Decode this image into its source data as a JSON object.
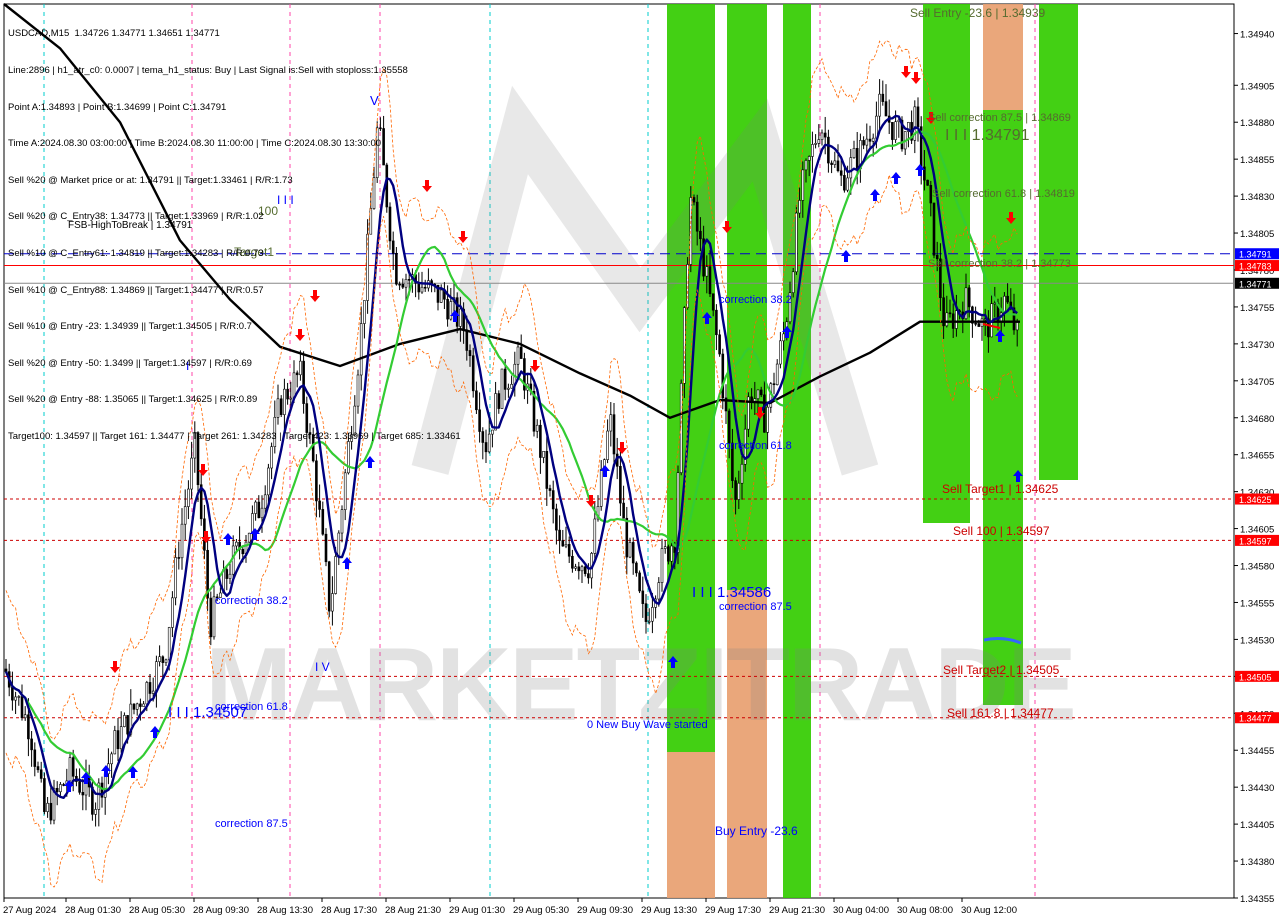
{
  "header": {
    "symbol_line": "USDCAD,M15  1.34726 1.34771 1.34651 1.34771",
    "info_lines": [
      "Line:2896 | h1_atr_c0: 0.0007 | tema_h1_status: Buy | Last Signal is:Sell with stoploss:1.35558",
      "Point A:1.34893 | Point B:1.34699 | Point C:1.34791",
      "Time A:2024.08.30 03:00:00 | Time B:2024.08.30 11:00:00 | Time C:2024.08.30 13:30:00",
      "Sell %20 @ Market price or at: 1.34791 || Target:1.33461 | R/R:1.73",
      "Sell %20 @ C_Entry38: 1.34773 || Target:1.33969 | R/R:1.02",
      "Sell %10 @ C_Entry61: 1.34819 || Target:1.34283 | R/R:0.73",
      "Sell %10 @ C_Entry88: 1.34869 || Target:1.34477 | R/R:0.57",
      "Sell %10 @ Entry -23: 1.34939 || Target:1.34505 | R/R:0.7",
      "Sell %20 @ Entry -50: 1.3499 || Target:1.34597 | R/R:0.69",
      "Sell %20 @ Entry -88: 1.35065 || Target:1.34625 | R/R:0.89",
      "Target100: 1.34597 || Target 161: 1.34477 | Target 261: 1.34283 | Target 423: 1.33969 | Target 685: 1.33461"
    ]
  },
  "chart_data": {
    "type": "candlestick",
    "symbol": "USDCAD",
    "timeframe": "M15",
    "ylim": [
      1.34355,
      1.3496
    ],
    "y_ticks": [
      "1.34940",
      "1.34905",
      "1.34880",
      "1.34855",
      "1.34830",
      "1.34805",
      "1.34780",
      "1.34755",
      "1.34730",
      "1.34705",
      "1.34680",
      "1.34655",
      "1.34630",
      "1.34605",
      "1.34580",
      "1.34555",
      "1.34530",
      "1.34505",
      "1.34480",
      "1.34455",
      "1.34430",
      "1.34405",
      "1.34380",
      "1.34355"
    ],
    "x_ticks": [
      "27 Aug 2024",
      "28 Aug 01:30",
      "28 Aug 05:30",
      "28 Aug 09:30",
      "28 Aug 13:30",
      "28 Aug 17:30",
      "28 Aug 21:30",
      "29 Aug 01:30",
      "29 Aug 05:30",
      "29 Aug 09:30",
      "29 Aug 13:30",
      "29 Aug 17:30",
      "29 Aug 21:30",
      "30 Aug 04:00",
      "30 Aug 08:00",
      "30 Aug 12:00"
    ],
    "price_badges": [
      {
        "value": "1.34791",
        "color": "#0000ff"
      },
      {
        "value": "1.34783",
        "color": "#ff0000"
      },
      {
        "value": "1.34771",
        "color": "#000000"
      },
      {
        "value": "1.34625",
        "color": "#ff0000"
      },
      {
        "value": "1.34597",
        "color": "#ff0000"
      },
      {
        "value": "1.34505",
        "color": "#ff0000"
      },
      {
        "value": "1.34477",
        "color": "#ff0000"
      }
    ],
    "horizontal_levels": [
      {
        "price": 1.34791,
        "color": "#0000cc",
        "style": "dashed"
      },
      {
        "price": 1.34783,
        "color": "#ff0000",
        "style": "solid"
      },
      {
        "price": 1.34771,
        "color": "#888888",
        "style": "solid"
      },
      {
        "price": 1.34625,
        "color": "#cc0000",
        "style": "dotted"
      },
      {
        "price": 1.34597,
        "color": "#cc0000",
        "style": "dotted"
      },
      {
        "price": 1.34505,
        "color": "#cc0000",
        "style": "dotted"
      },
      {
        "price": 1.34477,
        "color": "#cc0000",
        "style": "dotted"
      }
    ],
    "annotations": [
      {
        "text": "FSB-HighToBreak | 1.34791",
        "color": "#000000"
      },
      {
        "text": "Target1",
        "color": "#556b2f"
      },
      {
        "text": "100",
        "color": "#556b2f"
      },
      {
        "text": "I I I",
        "color": "#0000ff"
      },
      {
        "text": "V",
        "color": "#0000ff"
      },
      {
        "text": "I",
        "color": "#0000ff"
      },
      {
        "text": "I V",
        "color": "#0000ff"
      },
      {
        "text": "I I I 1.34507",
        "color": "#0000ff"
      },
      {
        "text": "correction 38.2",
        "color": "#0000ff"
      },
      {
        "text": "correction 61.8",
        "color": "#0000ff"
      },
      {
        "text": "correction 87.5",
        "color": "#0000ff"
      },
      {
        "text": "I I I 1.34586",
        "color": "#0000ff"
      },
      {
        "text": "correction 38.2",
        "color": "#0000ff"
      },
      {
        "text": "correction 61.8",
        "color": "#0000ff"
      },
      {
        "text": "correction 87.5",
        "color": "#0000ff"
      },
      {
        "text": "0 New Buy Wave started",
        "color": "#0000ff"
      },
      {
        "text": "Buy Entry -23.6",
        "color": "#0000ff"
      },
      {
        "text": "Sell Entry -23.6 | 1.34939",
        "color": "#556b2f"
      },
      {
        "text": "Sell correction 87.5 | 1.34869",
        "color": "#556b2f"
      },
      {
        "text": "I I I 1.34791",
        "color": "#556b2f"
      },
      {
        "text": "Sell correction 61.8 | 1.34819",
        "color": "#556b2f"
      },
      {
        "text": "Sell correction 38.2 | 1.34773",
        "color": "#556b2f"
      },
      {
        "text": "Sell Target1 | 1.34625",
        "color": "#cc0000"
      },
      {
        "text": "Sell 100 | 1.34597",
        "color": "#cc0000"
      },
      {
        "text": "Sell Target2 | 1.34505",
        "color": "#cc0000"
      },
      {
        "text": "Sell 161.8 | 1.34477",
        "color": "#cc0000"
      }
    ],
    "watermark": "MARKETZITRADE",
    "colors": {
      "green_zone": "#33cc00",
      "orange_zone": "#e8a070",
      "ma_fast": "#000080",
      "ma_mid": "#33cc33",
      "ma_slow": "#000000",
      "buy_arrow": "#0000ff",
      "sell_arrow": "#ff0000"
    }
  }
}
